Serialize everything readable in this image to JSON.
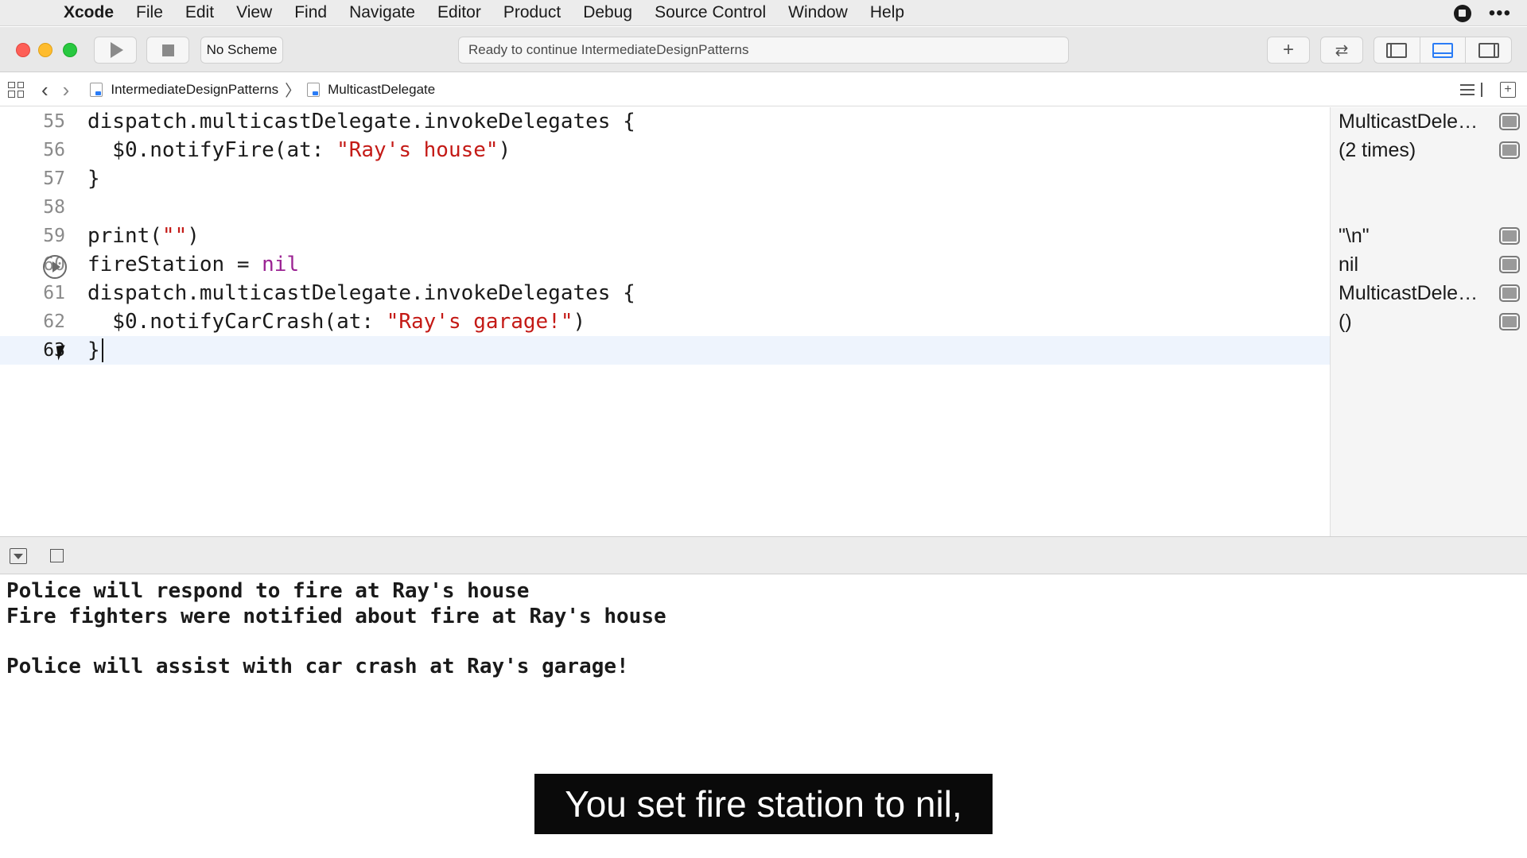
{
  "menubar": {
    "app_name": "Xcode",
    "items": [
      "File",
      "Edit",
      "View",
      "Find",
      "Navigate",
      "Editor",
      "Product",
      "Debug",
      "Source Control",
      "Window",
      "Help"
    ]
  },
  "toolbar": {
    "scheme_label": "No Scheme",
    "activity_text": "Ready to continue IntermediateDesignPatterns",
    "add_label": "+",
    "review_label": "⇄"
  },
  "jumpbar": {
    "crumb_project": "IntermediateDesignPatterns",
    "crumb_file": "MulticastDelegate"
  },
  "editor": {
    "lines": [
      {
        "num": "55",
        "segments": [
          {
            "t": "dispatch.multicastDelegate.invokeDelegates {",
            "c": ""
          }
        ]
      },
      {
        "num": "56",
        "segments": [
          {
            "t": "  $0.notifyFire(at: ",
            "c": ""
          },
          {
            "t": "\"Ray's house\"",
            "c": "str"
          },
          {
            "t": ")",
            "c": ""
          }
        ]
      },
      {
        "num": "57",
        "segments": [
          {
            "t": "}",
            "c": ""
          }
        ]
      },
      {
        "num": "58",
        "segments": []
      },
      {
        "num": "59",
        "segments": [
          {
            "t": "print(",
            "c": ""
          },
          {
            "t": "\"\"",
            "c": "str"
          },
          {
            "t": ")",
            "c": ""
          }
        ]
      },
      {
        "num": "60",
        "segments": [
          {
            "t": "fireStation = ",
            "c": ""
          },
          {
            "t": "nil",
            "c": "kw"
          }
        ]
      },
      {
        "num": "61",
        "segments": [
          {
            "t": "dispatch.multicastDelegate.invokeDelegates {",
            "c": ""
          }
        ]
      },
      {
        "num": "62",
        "segments": [
          {
            "t": "  $0.notifyCarCrash(at: ",
            "c": ""
          },
          {
            "t": "\"Ray's garage!\"",
            "c": "str"
          },
          {
            "t": ")",
            "c": ""
          }
        ]
      },
      {
        "num": "63",
        "segments": [
          {
            "t": "}",
            "c": ""
          }
        ],
        "current": true
      }
    ]
  },
  "results": [
    {
      "line": "55",
      "text": "MulticastDelegate<AlertPrototype>"
    },
    {
      "line": "56",
      "text": "(2 times)"
    },
    {
      "line": "59",
      "text": "\"\\n\""
    },
    {
      "line": "60",
      "text": "nil"
    },
    {
      "line": "61",
      "text": "MulticastDelegate<AlertPrototype>"
    },
    {
      "line": "62",
      "text": "()"
    }
  ],
  "console": {
    "lines": [
      "Police will respond to fire at Ray's house",
      "Fire fighters were notified about fire at Ray's house",
      "",
      "Police will assist with car crash at Ray's garage!"
    ]
  },
  "caption": {
    "text": "You set fire station to nil,"
  }
}
